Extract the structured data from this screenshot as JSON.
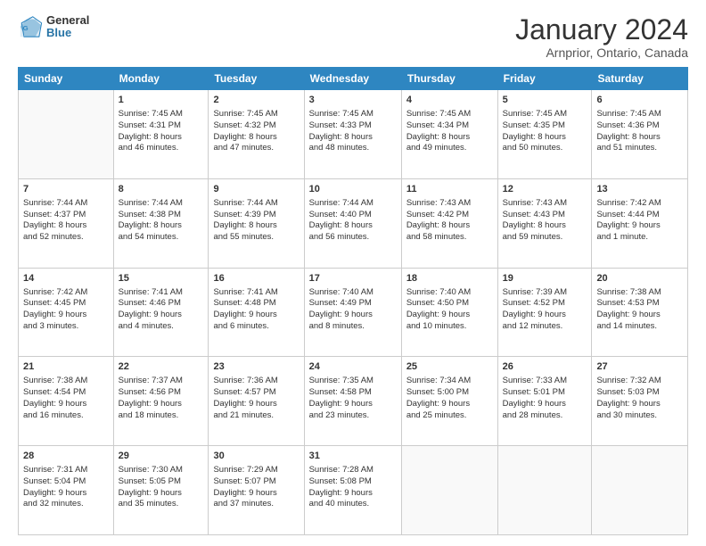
{
  "logo": {
    "general": "General",
    "blue": "Blue"
  },
  "header": {
    "title": "January 2024",
    "subtitle": "Arnprior, Ontario, Canada"
  },
  "days_of_week": [
    "Sunday",
    "Monday",
    "Tuesday",
    "Wednesday",
    "Thursday",
    "Friday",
    "Saturday"
  ],
  "weeks": [
    [
      {
        "day": "",
        "info": ""
      },
      {
        "day": "1",
        "info": "Sunrise: 7:45 AM\nSunset: 4:31 PM\nDaylight: 8 hours\nand 46 minutes."
      },
      {
        "day": "2",
        "info": "Sunrise: 7:45 AM\nSunset: 4:32 PM\nDaylight: 8 hours\nand 47 minutes."
      },
      {
        "day": "3",
        "info": "Sunrise: 7:45 AM\nSunset: 4:33 PM\nDaylight: 8 hours\nand 48 minutes."
      },
      {
        "day": "4",
        "info": "Sunrise: 7:45 AM\nSunset: 4:34 PM\nDaylight: 8 hours\nand 49 minutes."
      },
      {
        "day": "5",
        "info": "Sunrise: 7:45 AM\nSunset: 4:35 PM\nDaylight: 8 hours\nand 50 minutes."
      },
      {
        "day": "6",
        "info": "Sunrise: 7:45 AM\nSunset: 4:36 PM\nDaylight: 8 hours\nand 51 minutes."
      }
    ],
    [
      {
        "day": "7",
        "info": "Sunrise: 7:44 AM\nSunset: 4:37 PM\nDaylight: 8 hours\nand 52 minutes."
      },
      {
        "day": "8",
        "info": "Sunrise: 7:44 AM\nSunset: 4:38 PM\nDaylight: 8 hours\nand 54 minutes."
      },
      {
        "day": "9",
        "info": "Sunrise: 7:44 AM\nSunset: 4:39 PM\nDaylight: 8 hours\nand 55 minutes."
      },
      {
        "day": "10",
        "info": "Sunrise: 7:44 AM\nSunset: 4:40 PM\nDaylight: 8 hours\nand 56 minutes."
      },
      {
        "day": "11",
        "info": "Sunrise: 7:43 AM\nSunset: 4:42 PM\nDaylight: 8 hours\nand 58 minutes."
      },
      {
        "day": "12",
        "info": "Sunrise: 7:43 AM\nSunset: 4:43 PM\nDaylight: 8 hours\nand 59 minutes."
      },
      {
        "day": "13",
        "info": "Sunrise: 7:42 AM\nSunset: 4:44 PM\nDaylight: 9 hours\nand 1 minute."
      }
    ],
    [
      {
        "day": "14",
        "info": "Sunrise: 7:42 AM\nSunset: 4:45 PM\nDaylight: 9 hours\nand 3 minutes."
      },
      {
        "day": "15",
        "info": "Sunrise: 7:41 AM\nSunset: 4:46 PM\nDaylight: 9 hours\nand 4 minutes."
      },
      {
        "day": "16",
        "info": "Sunrise: 7:41 AM\nSunset: 4:48 PM\nDaylight: 9 hours\nand 6 minutes."
      },
      {
        "day": "17",
        "info": "Sunrise: 7:40 AM\nSunset: 4:49 PM\nDaylight: 9 hours\nand 8 minutes."
      },
      {
        "day": "18",
        "info": "Sunrise: 7:40 AM\nSunset: 4:50 PM\nDaylight: 9 hours\nand 10 minutes."
      },
      {
        "day": "19",
        "info": "Sunrise: 7:39 AM\nSunset: 4:52 PM\nDaylight: 9 hours\nand 12 minutes."
      },
      {
        "day": "20",
        "info": "Sunrise: 7:38 AM\nSunset: 4:53 PM\nDaylight: 9 hours\nand 14 minutes."
      }
    ],
    [
      {
        "day": "21",
        "info": "Sunrise: 7:38 AM\nSunset: 4:54 PM\nDaylight: 9 hours\nand 16 minutes."
      },
      {
        "day": "22",
        "info": "Sunrise: 7:37 AM\nSunset: 4:56 PM\nDaylight: 9 hours\nand 18 minutes."
      },
      {
        "day": "23",
        "info": "Sunrise: 7:36 AM\nSunset: 4:57 PM\nDaylight: 9 hours\nand 21 minutes."
      },
      {
        "day": "24",
        "info": "Sunrise: 7:35 AM\nSunset: 4:58 PM\nDaylight: 9 hours\nand 23 minutes."
      },
      {
        "day": "25",
        "info": "Sunrise: 7:34 AM\nSunset: 5:00 PM\nDaylight: 9 hours\nand 25 minutes."
      },
      {
        "day": "26",
        "info": "Sunrise: 7:33 AM\nSunset: 5:01 PM\nDaylight: 9 hours\nand 28 minutes."
      },
      {
        "day": "27",
        "info": "Sunrise: 7:32 AM\nSunset: 5:03 PM\nDaylight: 9 hours\nand 30 minutes."
      }
    ],
    [
      {
        "day": "28",
        "info": "Sunrise: 7:31 AM\nSunset: 5:04 PM\nDaylight: 9 hours\nand 32 minutes."
      },
      {
        "day": "29",
        "info": "Sunrise: 7:30 AM\nSunset: 5:05 PM\nDaylight: 9 hours\nand 35 minutes."
      },
      {
        "day": "30",
        "info": "Sunrise: 7:29 AM\nSunset: 5:07 PM\nDaylight: 9 hours\nand 37 minutes."
      },
      {
        "day": "31",
        "info": "Sunrise: 7:28 AM\nSunset: 5:08 PM\nDaylight: 9 hours\nand 40 minutes."
      },
      {
        "day": "",
        "info": ""
      },
      {
        "day": "",
        "info": ""
      },
      {
        "day": "",
        "info": ""
      }
    ]
  ]
}
